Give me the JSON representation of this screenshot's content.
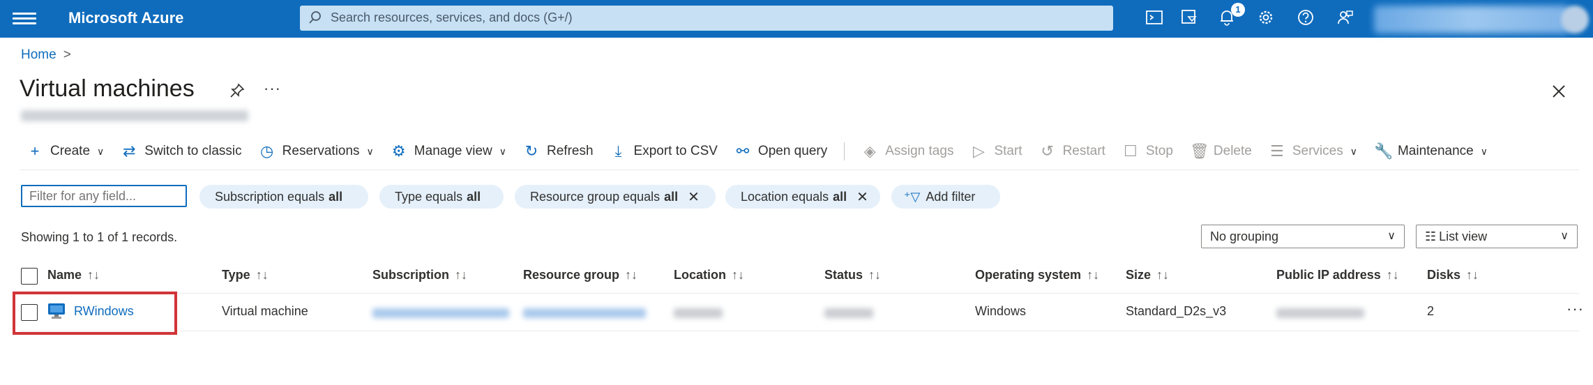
{
  "topbar": {
    "brand": "Microsoft Azure",
    "search_placeholder": "Search resources, services, and docs (G+/)",
    "notification_count": "1",
    "icons": [
      "cloud-shell-icon",
      "directory-filter-icon",
      "notifications-icon",
      "settings-icon",
      "help-icon",
      "feedback-icon"
    ]
  },
  "breadcrumb": {
    "home": "Home",
    "separator": ">"
  },
  "page": {
    "title": "Virtual machines",
    "more": "···"
  },
  "toolbar": {
    "create": "Create",
    "switch_to_classic": "Switch to classic",
    "reservations": "Reservations",
    "manage_view": "Manage view",
    "refresh": "Refresh",
    "export_csv": "Export to CSV",
    "open_query": "Open query",
    "assign_tags": "Assign tags",
    "start": "Start",
    "restart": "Restart",
    "stop": "Stop",
    "delete": "Delete",
    "services": "Services",
    "maintenance": "Maintenance"
  },
  "filters": {
    "input_placeholder": "Filter for any field...",
    "subscription": {
      "label": "Subscription equals",
      "value": "all"
    },
    "type": {
      "label": "Type equals",
      "value": "all"
    },
    "resource_group": {
      "label": "Resource group equals",
      "value": "all"
    },
    "location": {
      "label": "Location equals",
      "value": "all"
    },
    "add_filter": "Add filter"
  },
  "records_text": "Showing 1 to 1 of 1 records.",
  "grouping_select": "No grouping",
  "view_select": "List view",
  "table": {
    "columns": [
      "Name",
      "Type",
      "Subscription",
      "Resource group",
      "Location",
      "Status",
      "Operating system",
      "Size",
      "Public IP address",
      "Disks"
    ],
    "sort_glyph": "↑↓",
    "rows": [
      {
        "name": "RWindows",
        "type": "Virtual machine",
        "os": "Windows",
        "size": "Standard_D2s_v3",
        "disks": "2"
      }
    ]
  },
  "row_more": "···",
  "colors": {
    "accent": "#0f6cbd",
    "highlight": "#d13438",
    "pill": "#e5f0fa"
  }
}
